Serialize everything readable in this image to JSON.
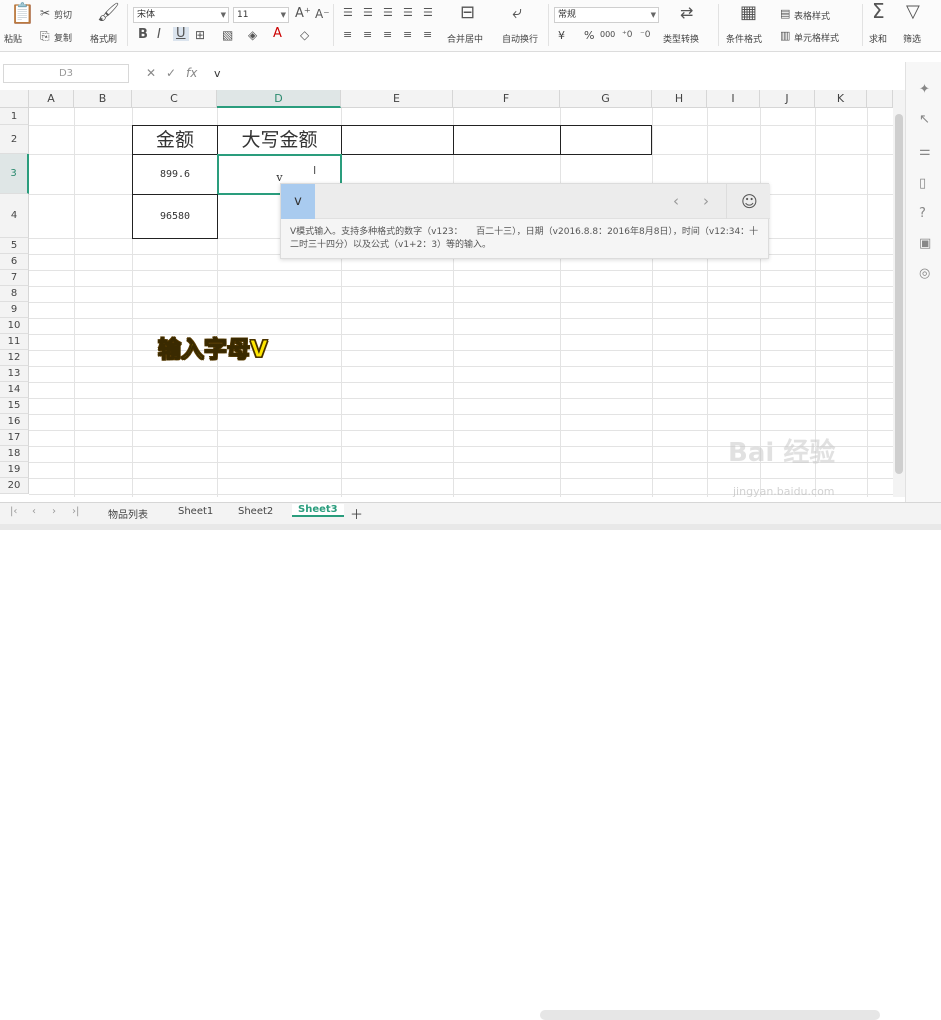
{
  "ribbon": {
    "paste": "粘贴",
    "cut": "剪切",
    "copy": "复制",
    "format_painter": "格式刷",
    "font_name": "宋体",
    "font_size": "11",
    "bold": "B",
    "italic": "I",
    "underline": "U",
    "merge_center": "合并居中",
    "wrap_text": "自动换行",
    "number_format": "常规",
    "currency": "¥",
    "percent": "%",
    "thousands": "000",
    "type_convert": "类型转换",
    "conditional_format": "条件格式",
    "table_style": "表格样式",
    "cell_style": "单元格样式",
    "sum": "求和",
    "filter": "筛选"
  },
  "formula_bar": {
    "name_box": "D3",
    "value": "v"
  },
  "columns": [
    "A",
    "B",
    "C",
    "D",
    "E",
    "F",
    "G",
    "H",
    "I",
    "J",
    "K"
  ],
  "rows": [
    "1",
    "2",
    "3",
    "4",
    "5",
    "6",
    "7",
    "8",
    "9",
    "10",
    "11",
    "12",
    "13",
    "14",
    "15",
    "16",
    "17",
    "18",
    "19",
    "20"
  ],
  "cells": {
    "C2": "金额",
    "D2": "大写金额",
    "C3": "899.6",
    "D3": "v",
    "C4": "96580"
  },
  "popup": {
    "key": "v",
    "help_text": "V模式输入。支持多种格式的数字（v123：　　百二十三），日期（v2016.8.8：2016年8月8日），时间（v12:34：十二时三十四分）以及公式（v1+2：3）等的输入。"
  },
  "caption": "输入字母V",
  "sheet_tabs": [
    "物品列表",
    "Sheet1",
    "Sheet2",
    "Sheet3"
  ],
  "active_sheet": "Sheet3",
  "watermark": {
    "brand": "Bai 经验",
    "url": "jingyan.baidu.com"
  },
  "colors": {
    "accent": "#2a9d7d",
    "popup_key_bg": "#a9cbef",
    "caption": "#ffe600"
  }
}
